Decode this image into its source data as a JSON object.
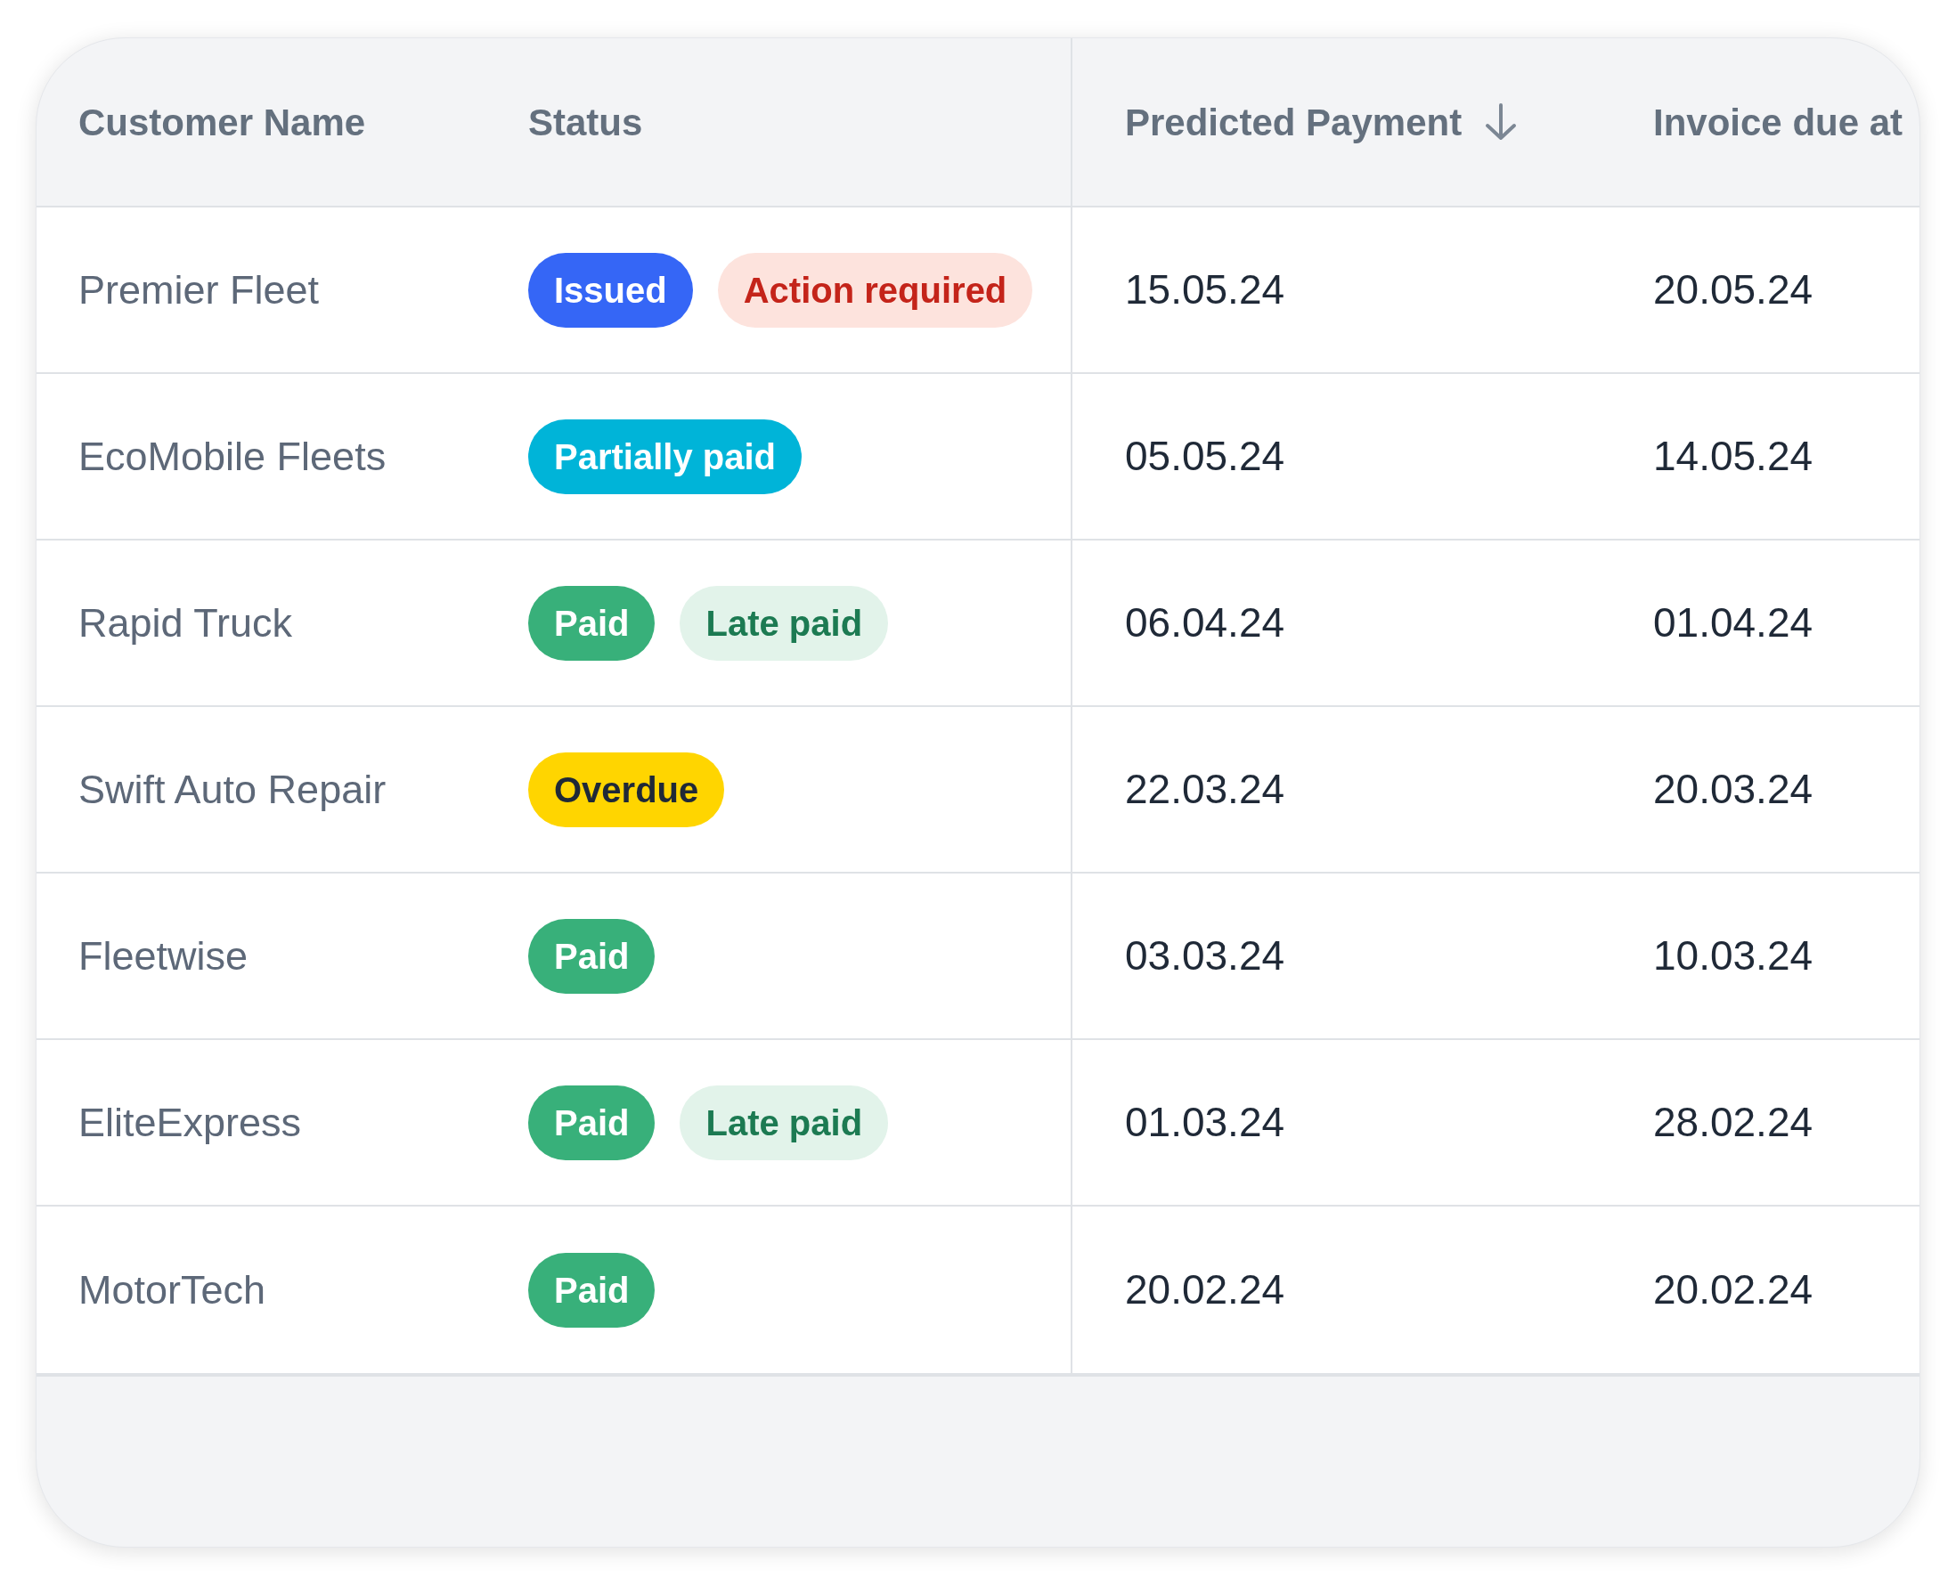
{
  "table": {
    "columns": [
      {
        "label": "Customer Name",
        "sorted": false
      },
      {
        "label": "Status",
        "sorted": false
      },
      {
        "label": "Predicted Payment",
        "sorted": true
      },
      {
        "label": "Invoice due at",
        "sorted": false
      }
    ],
    "rows": [
      {
        "customer": "Premier Fleet",
        "badges": [
          {
            "label": "Issued",
            "kind": "issued"
          },
          {
            "label": "Action required",
            "kind": "action"
          }
        ],
        "predicted": "15.05.24",
        "due": "20.05.24"
      },
      {
        "customer": "EcoMobile Fleets",
        "badges": [
          {
            "label": "Partially paid",
            "kind": "partial"
          }
        ],
        "predicted": "05.05.24",
        "due": "14.05.24"
      },
      {
        "customer": "Rapid Truck",
        "badges": [
          {
            "label": "Paid",
            "kind": "paid"
          },
          {
            "label": "Late paid",
            "kind": "late"
          }
        ],
        "predicted": "06.04.24",
        "due": "01.04.24"
      },
      {
        "customer": "Swift Auto Repair",
        "badges": [
          {
            "label": "Overdue",
            "kind": "overdue"
          }
        ],
        "predicted": "22.03.24",
        "due": "20.03.24"
      },
      {
        "customer": "Fleetwise",
        "badges": [
          {
            "label": "Paid",
            "kind": "paid"
          }
        ],
        "predicted": "03.03.24",
        "due": "10.03.24"
      },
      {
        "customer": "EliteExpress",
        "badges": [
          {
            "label": "Paid",
            "kind": "paid"
          },
          {
            "label": "Late paid",
            "kind": "late"
          }
        ],
        "predicted": "01.03.24",
        "due": "28.02.24"
      },
      {
        "customer": "MotorTech",
        "badges": [
          {
            "label": "Paid",
            "kind": "paid"
          }
        ],
        "predicted": "20.02.24",
        "due": "20.02.24"
      }
    ]
  }
}
